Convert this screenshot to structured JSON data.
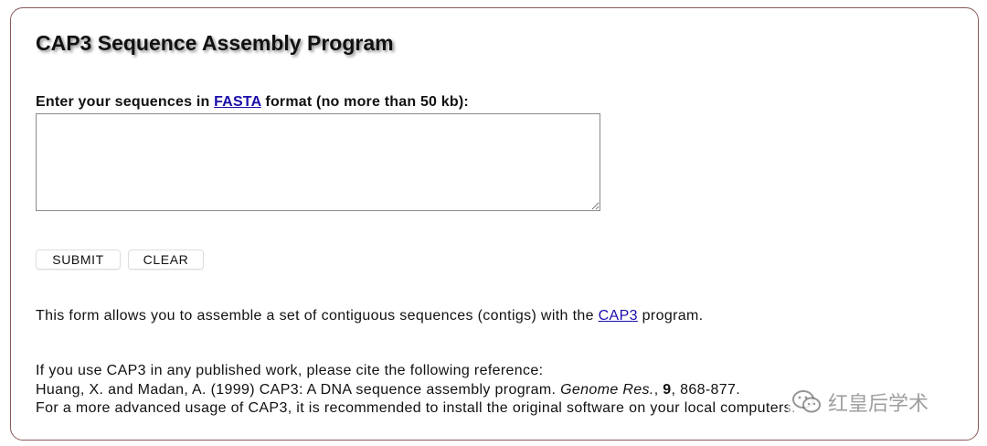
{
  "page": {
    "title": "CAP3 Sequence Assembly Program"
  },
  "form": {
    "prompt_before": "Enter your sequences in ",
    "prompt_link": "FASTA",
    "prompt_after": " format (no more than 50 kb):",
    "sequence_value": "",
    "submit_label": "SUBMIT",
    "clear_label": "CLEAR"
  },
  "description": {
    "before": "This form allows you to assemble a set of contiguous sequences (contigs) with the ",
    "link": "CAP3",
    "after": " program."
  },
  "citation": {
    "line1": "If you use CAP3 in any published work, please cite the following reference:",
    "ref_authors": "Huang, X. and Madan, A. (1999) CAP3: A DNA sequence assembly program. ",
    "ref_journal": "Genome Res.",
    "ref_sep": ", ",
    "ref_volume": "9",
    "ref_pages": ", 868-877.",
    "line3": "For a more advanced usage of CAP3, it is recommended to install the original software on your local computers."
  },
  "watermark": {
    "icon": "wechat-icon",
    "text": "红皇后学术"
  },
  "colors": {
    "link": "#1a0dab",
    "frame_border": "#8a5a5a"
  }
}
